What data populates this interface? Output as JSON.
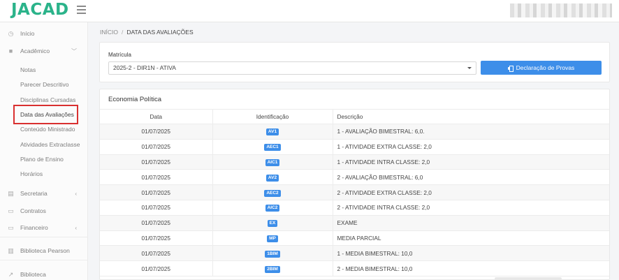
{
  "header": {
    "logo_text": "JACAD"
  },
  "sidebar": {
    "items": [
      {
        "label": "Início",
        "icon": "clock-icon"
      },
      {
        "label": "Acadêmico",
        "icon": "briefcase-icon",
        "expanded": true
      },
      {
        "label": "Secretaria",
        "icon": "file-icon"
      },
      {
        "label": "Contratos",
        "icon": "id-card-icon"
      },
      {
        "label": "Financeiro",
        "icon": "money-icon"
      },
      {
        "label": "Biblioteca Pearson",
        "icon": "book-icon"
      },
      {
        "label": "Biblioteca",
        "icon": "external-link-icon"
      }
    ],
    "academic_sub": [
      "Notas",
      "Parecer Descritivo",
      "Disciplinas Cursadas",
      "Data das Avaliações",
      "Conteúdo Ministrado",
      "Atividades Extraclasse",
      "Plano de Ensino",
      "Horários"
    ],
    "active_sub": "Data das Avaliações",
    "highlight_color": "#d93030"
  },
  "breadcrumb": {
    "home": "INÍCIO",
    "separator": "/",
    "current": "DATA DAS AVALIAÇÕES"
  },
  "filter": {
    "label": "Matrícula",
    "selected": "2025-2 - DIR1N - ATIVA",
    "button_label": "Declaração de Provas",
    "button_color": "#3d8ee9"
  },
  "table": {
    "title": "Economia Política",
    "headers": [
      "Data",
      "Identificação",
      "Descrição"
    ],
    "rows": [
      {
        "date": "01/07/2025",
        "id": "AV1",
        "desc": "1 - AVALIAÇÃO BIMESTRAL: 6,0."
      },
      {
        "date": "01/07/2025",
        "id": "AEC1",
        "desc": "1 - ATIVIDADE EXTRA CLASSE: 2,0"
      },
      {
        "date": "01/07/2025",
        "id": "AIC1",
        "desc": "1 - ATIVIDADE INTRA CLASSE: 2,0"
      },
      {
        "date": "01/07/2025",
        "id": "AV2",
        "desc": "2 - AVALIAÇÃO BIMESTRAL: 6,0"
      },
      {
        "date": "01/07/2025",
        "id": "AEC2",
        "desc": "2 - ATIVIDADE EXTRA CLASSE: 2,0"
      },
      {
        "date": "01/07/2025",
        "id": "AIC2",
        "desc": "2 - ATIVIDADE INTRA CLASSE: 2,0"
      },
      {
        "date": "01/07/2025",
        "id": "EX",
        "desc": "EXAME"
      },
      {
        "date": "01/07/2025",
        "id": "MP",
        "desc": "MEDIA PARCIAL"
      },
      {
        "date": "01/07/2025",
        "id": "1BIM",
        "desc": "1 - MEDIA BIMESTRAL: 10,0"
      },
      {
        "date": "01/07/2025",
        "id": "2BIM",
        "desc": "2 - MEDIA BIMESTRAL: 10,0"
      }
    ],
    "badge_color": "#3d8ee9"
  }
}
